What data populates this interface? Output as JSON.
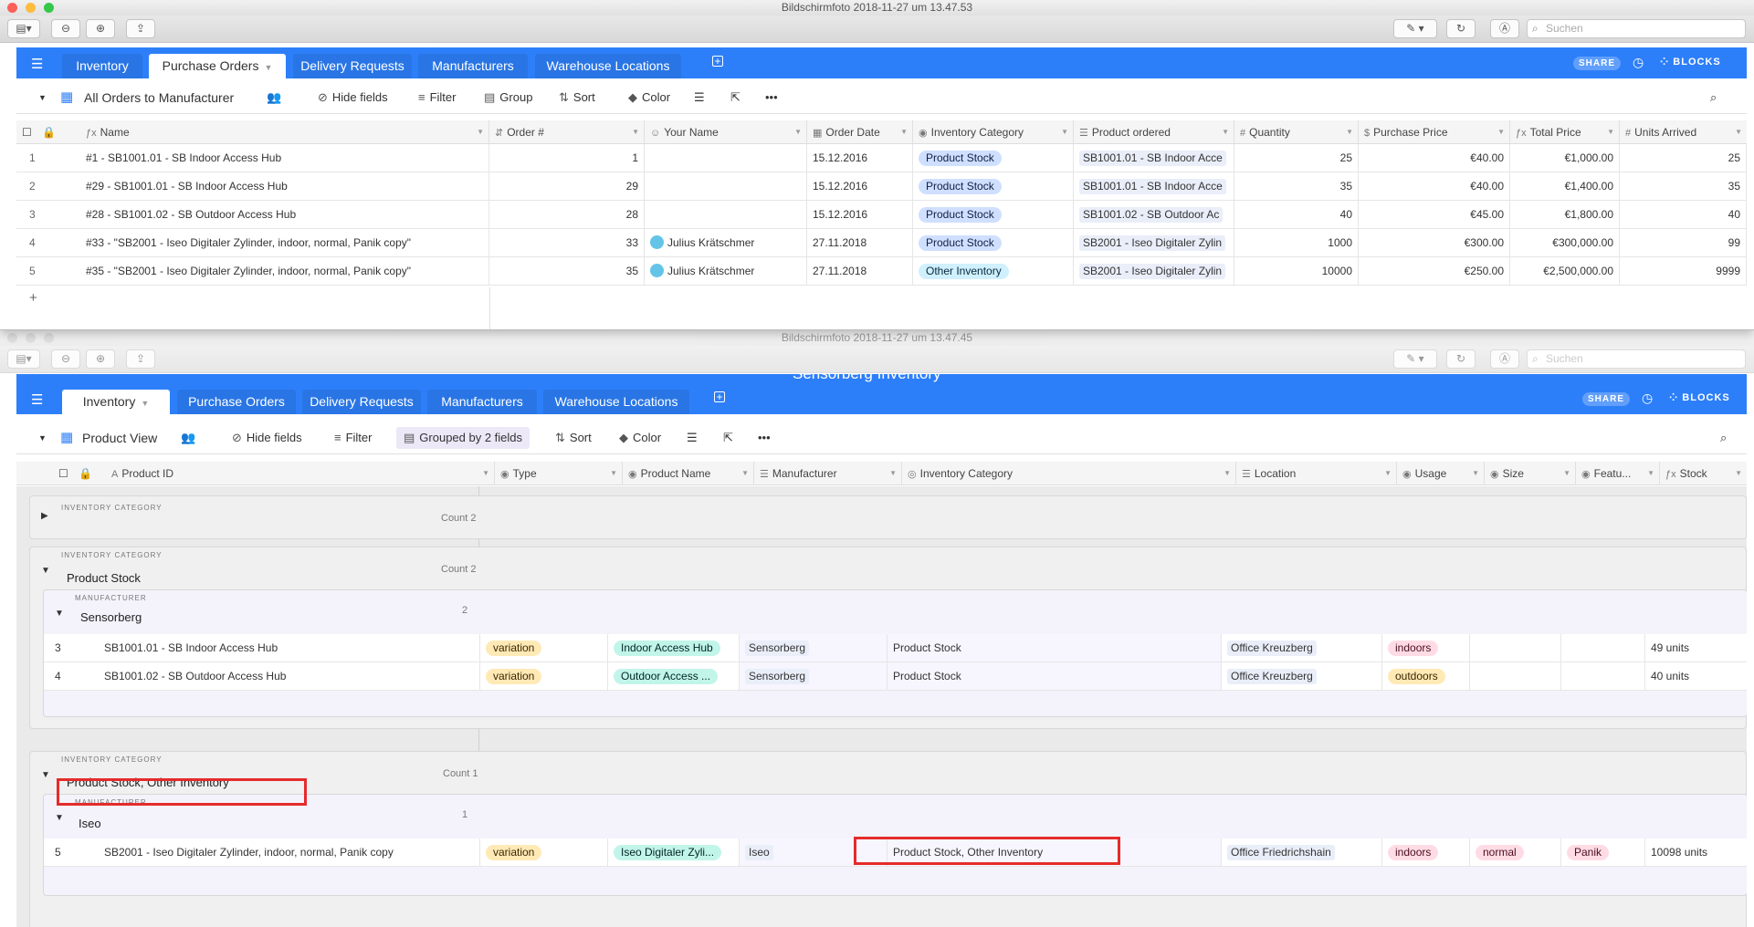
{
  "top_window": {
    "title": "Bildschirmfoto 2018-11-27 um 13.47.53",
    "search_placeholder": "Suchen",
    "tabs": [
      {
        "label": "Inventory"
      },
      {
        "label": "Purchase Orders"
      },
      {
        "label": "Delivery Requests"
      },
      {
        "label": "Manufacturers"
      },
      {
        "label": "Warehouse Locations"
      }
    ],
    "share_label": "SHARE",
    "blocks_label": "BLOCKS",
    "view_name": "All Orders to Manufacturer",
    "toolbar": {
      "hide_fields": "Hide fields",
      "filter": "Filter",
      "group": "Group",
      "sort": "Sort",
      "color": "Color"
    },
    "columns": [
      "Name",
      "Order #",
      "Your Name",
      "Order Date",
      "Inventory Category",
      "Product ordered",
      "Quantity",
      "Purchase Price",
      "Total Price",
      "Units Arrived"
    ],
    "rows": [
      {
        "n": "1",
        "name": "#1 - SB1001.01 - SB Indoor Access Hub",
        "order": "1",
        "your_name": "",
        "date": "15.12.2016",
        "category": "Product Stock",
        "product": "SB1001.01 - SB Indoor Acce",
        "qty": "25",
        "price": "€40.00",
        "total": "€1,000.00",
        "arrived": "25"
      },
      {
        "n": "2",
        "name": "#29 - SB1001.01 - SB Indoor Access Hub",
        "order": "29",
        "your_name": "",
        "date": "15.12.2016",
        "category": "Product Stock",
        "product": "SB1001.01 - SB Indoor Acce",
        "qty": "35",
        "price": "€40.00",
        "total": "€1,400.00",
        "arrived": "35"
      },
      {
        "n": "3",
        "name": "#28 - SB1001.02 - SB Outdoor Access Hub",
        "order": "28",
        "your_name": "",
        "date": "15.12.2016",
        "category": "Product Stock",
        "product": "SB1001.02 - SB Outdoor Ac",
        "qty": "40",
        "price": "€45.00",
        "total": "€1,800.00",
        "arrived": "40"
      },
      {
        "n": "4",
        "name": "#33 - \"SB2001 - Iseo Digitaler Zylinder, indoor, normal, Panik copy\"",
        "order": "33",
        "your_name": "Julius Krätschmer",
        "date": "27.11.2018",
        "category": "Product Stock",
        "product": "SB2001 - Iseo Digitaler Zylin",
        "qty": "1000",
        "price": "€300.00",
        "total": "€300,000.00",
        "arrived": "99"
      },
      {
        "n": "5",
        "name": "#35 - \"SB2001 - Iseo Digitaler Zylinder, indoor, normal, Panik copy\"",
        "order": "35",
        "your_name": "Julius Krätschmer",
        "date": "27.11.2018",
        "category": "Other Inventory",
        "product": "SB2001 - Iseo Digitaler Zylin",
        "qty": "10000",
        "price": "€250.00",
        "total": "€2,500,000.00",
        "arrived": "9999"
      }
    ],
    "add_row": "+"
  },
  "bottom_window": {
    "title": "Bildschirmfoto 2018-11-27 um 13.47.45",
    "search_placeholder": "Suchen",
    "base_name": "Sensorberg Inventory",
    "tabs": [
      {
        "label": "Inventory"
      },
      {
        "label": "Purchase Orders"
      },
      {
        "label": "Delivery Requests"
      },
      {
        "label": "Manufacturers"
      },
      {
        "label": "Warehouse Locations"
      }
    ],
    "share_label": "SHARE",
    "blocks_label": "BLOCKS",
    "view_name": "Product View",
    "toolbar": {
      "hide_fields": "Hide fields",
      "filter": "Filter",
      "grouped": "Grouped by 2 fields",
      "sort": "Sort",
      "color": "Color"
    },
    "columns": [
      "Product ID",
      "Type",
      "Product Name",
      "Manufacturer",
      "Inventory Category",
      "Location",
      "Usage",
      "Size",
      "Featu...",
      "Stock"
    ],
    "group_label": "INVENTORY CATEGORY",
    "manufacturer_label": "MANUFACTURER",
    "groups": [
      {
        "value": "",
        "count": "Count 2"
      },
      {
        "value": "Product Stock",
        "count": "Count 2",
        "manufacturer": "Sensorberg",
        "mcount": "2",
        "rows": [
          {
            "n": "3",
            "id": "SB1001.01 - SB Indoor Access Hub",
            "type": "variation",
            "pname": "Indoor Access Hub",
            "manu": "Sensorberg",
            "cat": "Product Stock",
            "loc": "Office Kreuzberg",
            "usage": "indoors",
            "size": "",
            "feat": "",
            "stock": "49 units"
          },
          {
            "n": "4",
            "id": "SB1001.02 - SB Outdoor Access Hub",
            "type": "variation",
            "pname": "Outdoor Access ...",
            "manu": "Sensorberg",
            "cat": "Product Stock",
            "loc": "Office Kreuzberg",
            "usage": "outdoors",
            "size": "",
            "feat": "",
            "stock": "40 units"
          }
        ]
      },
      {
        "value": "Product Stock, Other Inventory",
        "count": "Count 1",
        "manufacturer": "Iseo",
        "mcount": "1",
        "rows": [
          {
            "n": "5",
            "id": "SB2001 - Iseo Digitaler Zylinder, indoor, normal, Panik copy",
            "type": "variation",
            "pname": "Iseo Digitaler Zyli...",
            "manu": "Iseo",
            "cat": "Product Stock, Other Inventory",
            "loc": "Office Friedrichshain",
            "usage": "indoors",
            "size": "normal",
            "feat": "Panik",
            "stock": "10098 units"
          }
        ]
      }
    ]
  }
}
